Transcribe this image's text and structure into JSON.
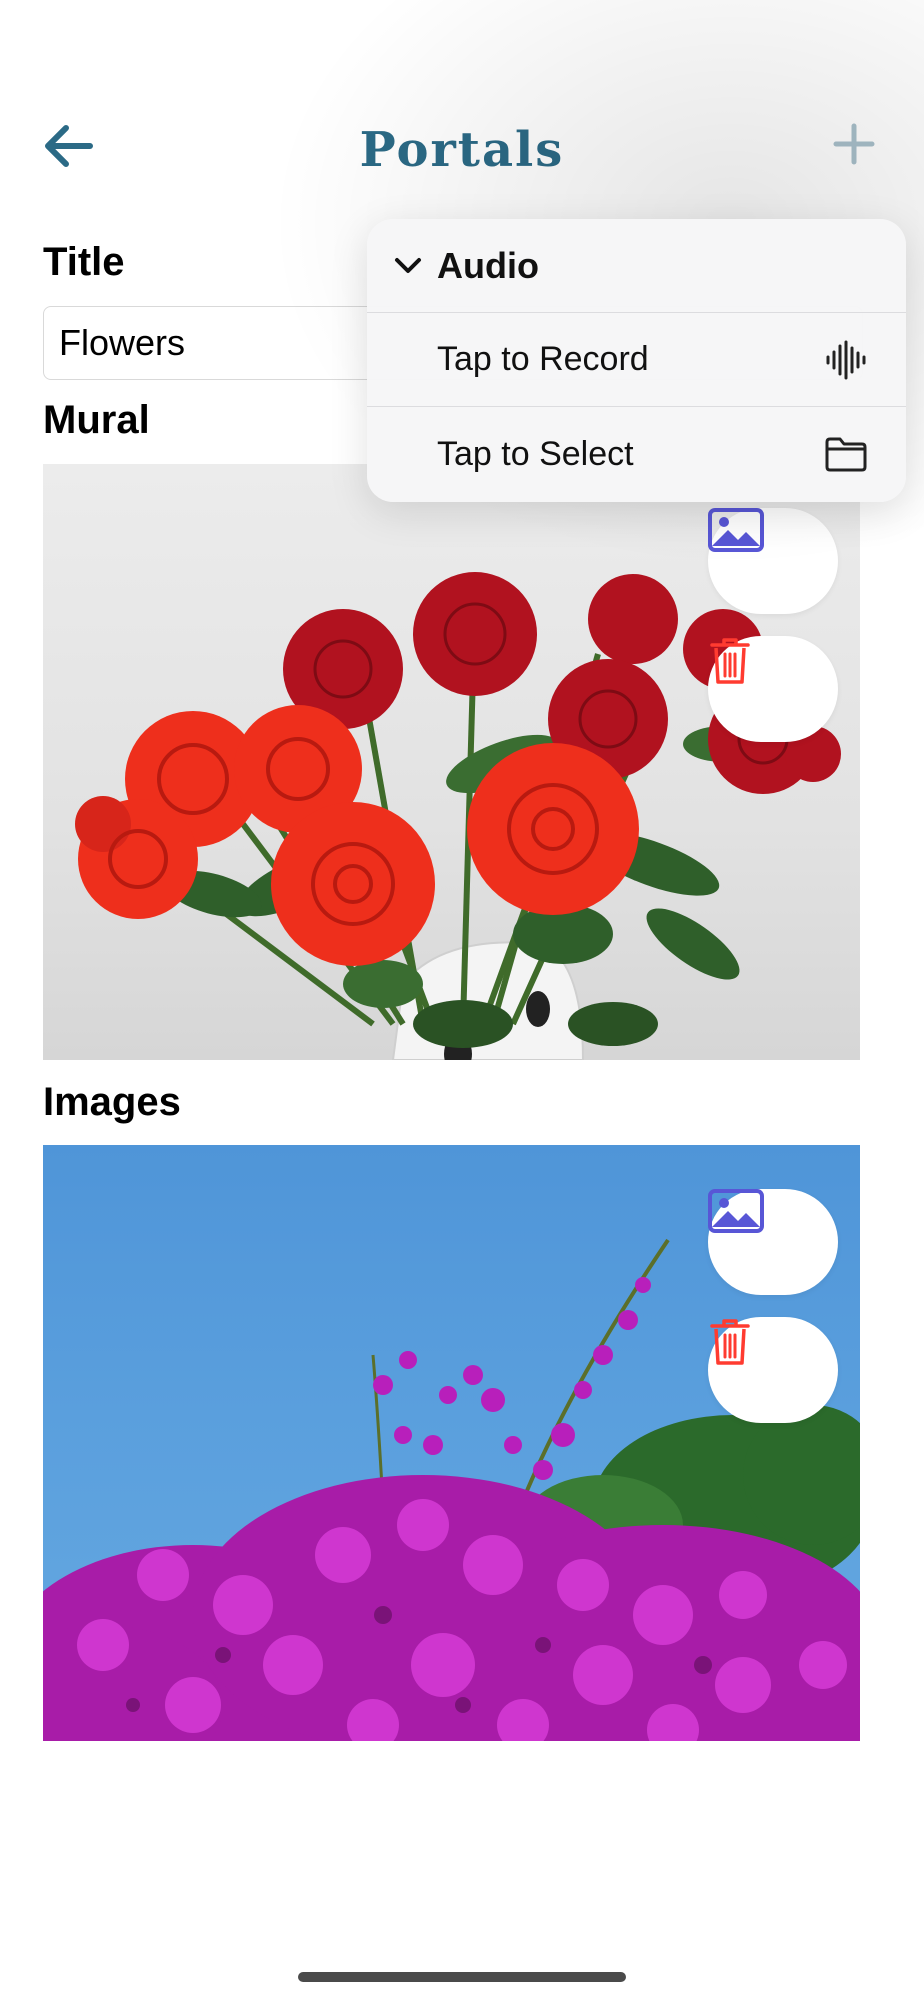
{
  "nav": {
    "title": "Portals",
    "back_icon": "arrow-left-icon",
    "add_icon": "plus-icon",
    "accent_color": "#2b6a86"
  },
  "form": {
    "title_label": "Title",
    "title_value": "Flowers",
    "mural_label": "Mural",
    "images_label": "Images"
  },
  "mural": {
    "image": "red-roses-bouquet",
    "buttons": [
      {
        "icon": "photo-icon",
        "color": "#5856d6"
      },
      {
        "icon": "trash-icon",
        "color": "#ff3b30"
      }
    ]
  },
  "images": {
    "image": "bougainvillea-blue-sky",
    "buttons": [
      {
        "icon": "photo-icon",
        "color": "#5856d6"
      },
      {
        "icon": "trash-icon",
        "color": "#ff3b30"
      }
    ]
  },
  "menu": {
    "header": "Audio",
    "header_icon": "chevron-down-icon",
    "items": [
      {
        "label": "Tap to Record",
        "icon": "waveform-icon"
      },
      {
        "label": "Tap to Select",
        "icon": "folder-icon"
      }
    ]
  }
}
